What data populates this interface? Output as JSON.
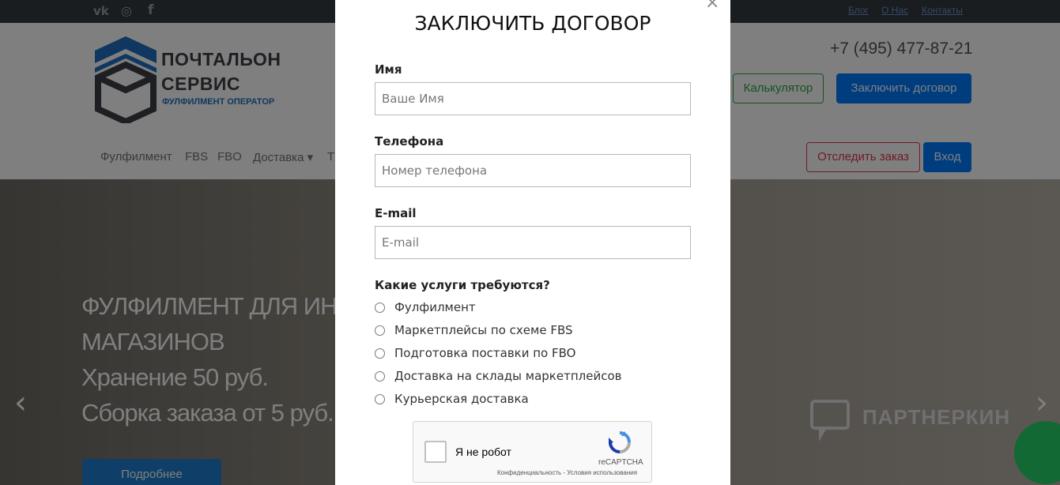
{
  "topbar": {
    "social": [
      {
        "name": "vk-icon",
        "glyph": "vk"
      },
      {
        "name": "instagram-icon",
        "glyph": "◎"
      },
      {
        "name": "facebook-icon",
        "glyph": "f"
      }
    ],
    "links": [
      "Блог",
      "О Нас",
      "Контакты"
    ]
  },
  "header": {
    "logo_line1": "ПОЧТАЛЬОН",
    "logo_line2": "СЕРВИС",
    "logo_line3": "ФУЛФИЛМЕНТ ОПЕРАТОР",
    "phone": "+7 (495) 477-87-21",
    "calc_button": "Калькулятор",
    "contract_button": "Заключить договор",
    "track_button": "Отследить заказ",
    "login_button": "Вход",
    "nav": [
      "Фулфилмент",
      "FBS",
      "FBO",
      "Доставка ▾",
      "Т"
    ]
  },
  "hero": {
    "line1": "ФУЛФИЛМЕНТ ДЛЯ ИНТ",
    "line2": "МАГАЗИНОВ",
    "line3": "Хранение 50 руб.",
    "line4": "Сборка заказа от 5 руб.",
    "more_button": "Подробнее",
    "prev_arrow": "‹",
    "next_arrow": "›",
    "partner_text": "ПАРТНЕРКИН"
  },
  "modal": {
    "close": "×",
    "title": "ЗАКЛЮЧИТЬ ДОГОВОР",
    "name_label": "Имя",
    "name_placeholder": "Ваше Имя",
    "phone_label": "Телефона",
    "phone_placeholder": "Номер телефона",
    "email_label": "E-mail",
    "email_placeholder": "E-mail",
    "services_label": "Какие услуги требуются?",
    "services": [
      "Фулфилмент",
      "Маркетплейсы по схеме FBS",
      "Подготовка поставки по FBO",
      "Доставка на склады маркетплейсов",
      "Курьерская доставка"
    ],
    "recaptcha": {
      "label": "Я не робот",
      "brand": "reCAPTCHA",
      "terms": "Конфиденциальность - Условия использования"
    }
  },
  "colors": {
    "primary": "#007bff",
    "success": "#28a745",
    "danger": "#dc3545",
    "logo_blue": "#1e6fc0",
    "overlay": "rgba(0,0,0,0.5)"
  }
}
